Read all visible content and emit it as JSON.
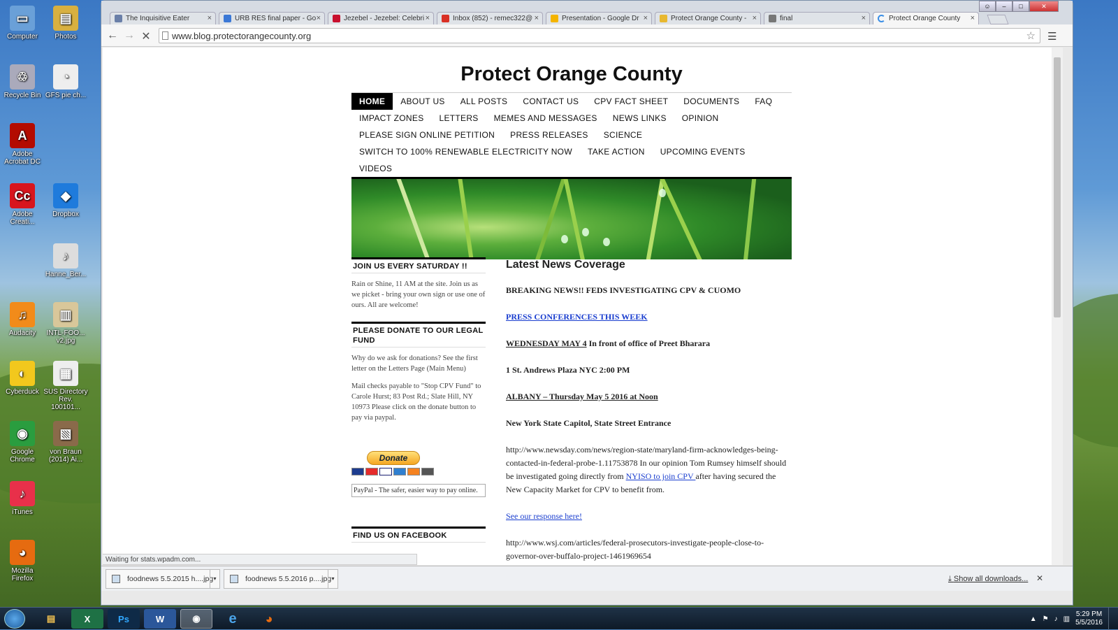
{
  "desktop": {
    "icons": [
      {
        "label": "Computer",
        "glyph": "▭",
        "color": "#6aa0d8"
      },
      {
        "label": "Photos",
        "glyph": "▤",
        "color": "#d8b040"
      },
      {
        "label": "Recycle Bin",
        "glyph": "♲",
        "color": "#aab"
      },
      {
        "label": "GFS pie ch...",
        "glyph": "◔",
        "color": "#eee"
      },
      {
        "label": "Adobe Acrobat DC",
        "glyph": "A",
        "color": "#b30b00"
      },
      {
        "label": "Adobe Creati...",
        "glyph": "Cc",
        "color": "#d8151d"
      },
      {
        "label": "Dropbox",
        "glyph": "◆",
        "color": "#1f7bdc"
      },
      {
        "label": "Hanne_Ber...",
        "glyph": "♪",
        "color": "#ddd"
      },
      {
        "label": "Audacity",
        "glyph": "♫",
        "color": "#f28b1a"
      },
      {
        "label": "INTL-FOO... v2.jpg",
        "glyph": "▥",
        "color": "#d9c79a"
      },
      {
        "label": "Cyberduck",
        "glyph": "◐",
        "color": "#f2c81d"
      },
      {
        "label": "SUS Directory Rev. 100101...",
        "glyph": "▦",
        "color": "#eee"
      },
      {
        "label": "Google Chrome",
        "glyph": "◉",
        "color": "#2a9d3f"
      },
      {
        "label": "von Braun (2014) Ai...",
        "glyph": "▧",
        "color": "#8a6a4a"
      },
      {
        "label": "iTunes",
        "glyph": "♪",
        "color": "#e8304a"
      },
      {
        "label": "Mozilla Firefox",
        "glyph": "◕",
        "color": "#e66b10"
      }
    ]
  },
  "browser": {
    "tabs": [
      {
        "title": "The Inquisitive Eater",
        "icon_color": "#6a7fa8"
      },
      {
        "title": "URB RES final paper - Go",
        "icon_color": "#3b78d6"
      },
      {
        "title": "Jezebel - Jezebel: Celebri",
        "icon_color": "#c8102e"
      },
      {
        "title": "Inbox (852) - remec322@",
        "icon_color": "#d93025"
      },
      {
        "title": "Presentation - Google Dr",
        "icon_color": "#f4b400"
      },
      {
        "title": "Protect Orange County -",
        "icon_color": "#e8b830"
      },
      {
        "title": "final",
        "icon_color": "#777"
      },
      {
        "title": "Protect Orange County",
        "icon_color": "#3a8ee6"
      }
    ],
    "url": "www.blog.protectorangecounty.org",
    "status_text": "Waiting for stats.wpadm.com...",
    "downloads": [
      {
        "name": "foodnews 5.5.2015 h....jpg"
      },
      {
        "name": "foodnews 5.5.2016 p....jpg"
      }
    ],
    "show_all_downloads": "Show all downloads..."
  },
  "site": {
    "title": "Protect Orange County",
    "nav": [
      "HOME",
      "ABOUT US",
      "ALL POSTS",
      "CONTACT US",
      "CPV FACT SHEET",
      "DOCUMENTS",
      "FAQ",
      "IMPACT ZONES",
      "LETTERS",
      "MEMES AND MESSAGES",
      "NEWS LINKS",
      "OPINION",
      "PLEASE SIGN ONLINE PETITION",
      "PRESS RELEASES",
      "SCIENCE",
      "SWITCH TO 100% RENEWABLE ELECTRICITY NOW",
      "TAKE ACTION",
      "UPCOMING EVENTS",
      "VIDEOS"
    ],
    "sidebar": {
      "w1_title": "JOIN US EVERY SATURDAY !!",
      "w1_text": "Rain or Shine, 11 AM at the site. Join us as we picket - bring your own sign or use one of ours. All are welcome!",
      "w2_title": "PLEASE DONATE TO OUR LEGAL FUND",
      "w2_text1": "Why do we ask for donations? See the first letter on the Letters Page (Main Menu)",
      "w2_text2": "Mail checks payable to \"Stop CPV Fund\" to Carole Hurst; 83 Post Rd.; Slate Hill, NY 10973 Please click on the donate button to pay via paypal.",
      "donate_label": "Donate",
      "paypal_caption": "PayPal - The safer, easier way to pay online.",
      "w3_title": "FIND US ON FACEBOOK"
    },
    "content": {
      "heading": "Latest News Coverage",
      "p1": "BREAKING NEWS!! FEDS INVESTIGATING CPV & CUOMO",
      "p2_link": "PRESS CONFERENCES THIS WEEK",
      "p3_underlined": "WEDNESDAY MAY 4",
      "p3_rest": " In front of office of Preet Bharara",
      "p4": "1 St. Andrews Plaza  NYC 2:00 PM",
      "p5": "ALBANY – Thursday May 5 2016 at Noon",
      "p6": "New York State Capitol, State Street Entrance",
      "p7_a": "http://www.newsday.com/news/region-state/maryland-firm-acknowledges-being-contacted-in-federal-probe-1.11753878  In our opinion Tom Rumsey himself should be investigated going directly from ",
      "p7_link": "NYISO  to join CPV ",
      "p7_b": "after having secured the New Capacity Market for CPV to benefit from.",
      "p8_link": "See our response here!",
      "p9": "http://www.wsj.com/articles/federal-prosecutors-investigate-people-close-to-governor-over-buffalo-project-1461969654"
    }
  },
  "taskbar": {
    "time": "5:29 PM",
    "date": "5/5/2016"
  }
}
